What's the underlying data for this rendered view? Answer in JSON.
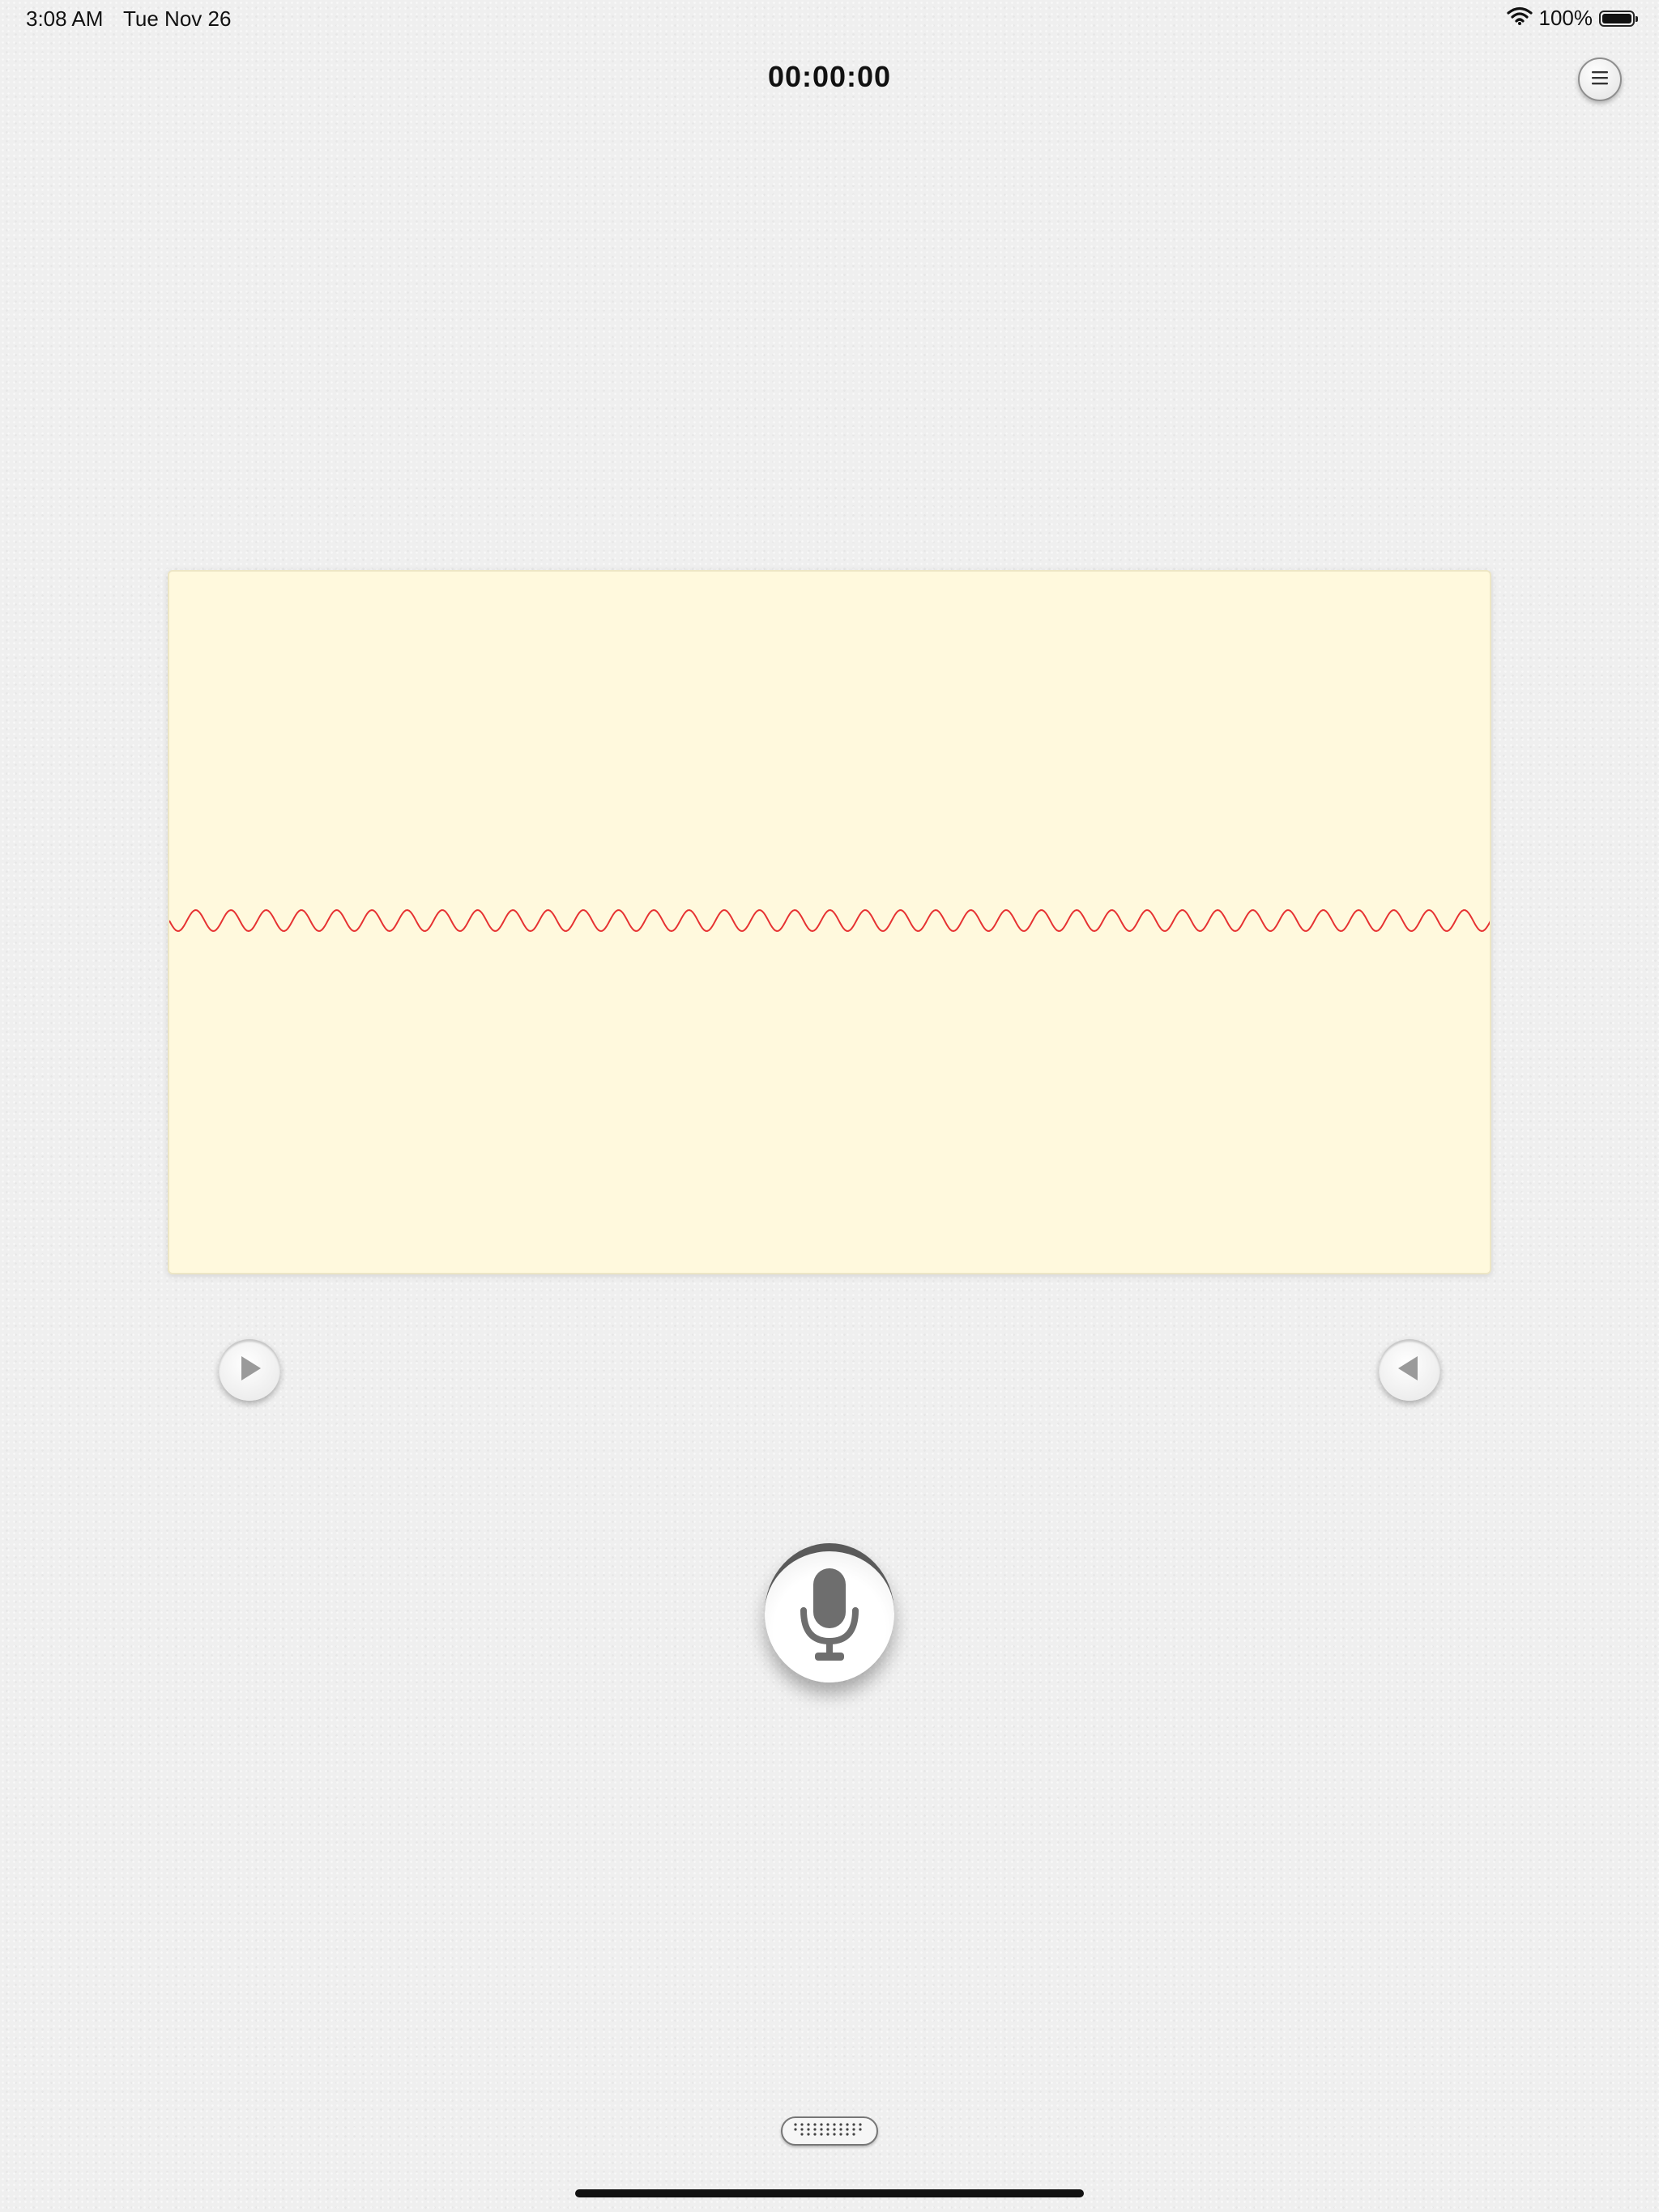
{
  "status_bar": {
    "time": "3:08 AM",
    "date": "Tue Nov 26",
    "battery_percent": "100%",
    "battery_level": 1.0,
    "icons": [
      "wifi-icon",
      "battery-icon"
    ]
  },
  "header": {
    "timer": "00:00:00",
    "menu_icon": "list-menu-icon"
  },
  "waveform": {
    "background_color": "#fff9dd",
    "line_color": "#e63232"
  },
  "controls": {
    "left_icon": "play-right-icon",
    "right_icon": "play-left-icon",
    "record_icon": "microphone-icon",
    "keyboard_icon": "keyboard-icon"
  }
}
